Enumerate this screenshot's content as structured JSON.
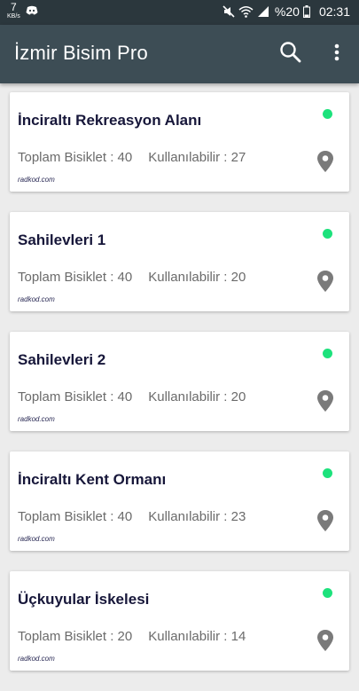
{
  "status_bar": {
    "speed_value": "7",
    "speed_unit": "KB/s",
    "battery": "%20",
    "time": "02:31"
  },
  "app_bar": {
    "title": "İzmir Bisim Pro",
    "icons": [
      "search-icon",
      "more-vert-icon"
    ]
  },
  "stations": [
    {
      "name": "İnciraltı Rekreasyon Alanı",
      "total_label": "Toplam Bisiklet :",
      "total": "40",
      "available_label": "Kullanılabilir :",
      "available": "27",
      "credit": "radkod.com",
      "status_color": "#1de27c"
    },
    {
      "name": "Sahilevleri 1",
      "total_label": "Toplam Bisiklet :",
      "total": "40",
      "available_label": "Kullanılabilir :",
      "available": "20",
      "credit": "radkod.com",
      "status_color": "#1de27c"
    },
    {
      "name": "Sahilevleri 2",
      "total_label": "Toplam Bisiklet :",
      "total": "40",
      "available_label": "Kullanılabilir :",
      "available": "20",
      "credit": "radkod.com",
      "status_color": "#1de27c"
    },
    {
      "name": "İnciraltı Kent Ormanı",
      "total_label": "Toplam Bisiklet :",
      "total": "40",
      "available_label": "Kullanılabilir :",
      "available": "23",
      "credit": "radkod.com",
      "status_color": "#1de27c"
    },
    {
      "name": "Üçkuyular İskelesi",
      "total_label": "Toplam Bisiklet :",
      "total": "20",
      "available_label": "Kullanılabilir :",
      "available": "14",
      "credit": "radkod.com",
      "status_color": "#1de27c"
    }
  ]
}
